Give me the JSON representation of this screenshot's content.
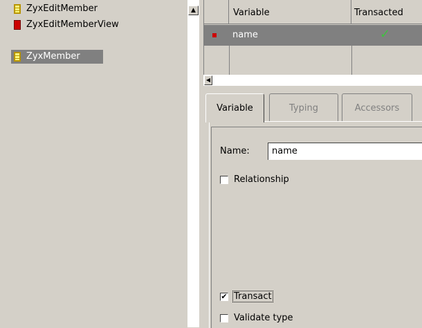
{
  "class_list": {
    "items": [
      {
        "label": "ZyxEditMember",
        "icon": "yellow-class-icon"
      },
      {
        "label": "ZyxEditMemberView",
        "icon": "red-class-icon"
      },
      {
        "label": "ZyxMember",
        "icon": "yellow-class-icon",
        "selected": true
      }
    ],
    "scroll_up_glyph": "▲"
  },
  "table": {
    "columns": [
      "Variable",
      "Transacted"
    ],
    "rows": [
      {
        "variable": "name",
        "transacted_glyph": "✓",
        "marker_color": "#cc0000"
      }
    ],
    "scroll_left_glyph": "◀"
  },
  "tabs": [
    "Variable",
    "Typing",
    "Accessors"
  ],
  "details": {
    "name_label": "Name:",
    "name_value": "name",
    "relationship_label": "Relationship",
    "relationship_checked": false,
    "transact_label": "Transact",
    "transact_checked": true,
    "validate_type_label": "Validate type",
    "validate_type_checked": false,
    "check_glyph": "✔"
  },
  "colors": {
    "panel_bg": "#d4d0c8",
    "selection_bg": "#808080",
    "check_green": "#40c040"
  }
}
